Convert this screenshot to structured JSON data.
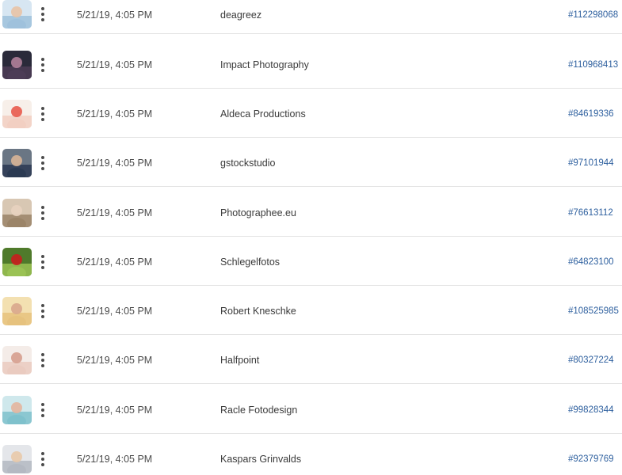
{
  "rows": [
    {
      "date": "5/21/19, 4:05 PM",
      "contributor": "deagreez",
      "asset_id": "#112298068",
      "thumb_icon": "man-portrait-photo-icon",
      "thumb_colors": [
        "#d7e6f2",
        "#9fc1dc",
        "#e9c3a6"
      ]
    },
    {
      "date": "5/21/19, 4:05 PM",
      "contributor": "Impact Photography",
      "asset_id": "#110968413",
      "thumb_icon": "dark-photo-icon",
      "thumb_colors": [
        "#2a2a3a",
        "#4c3c56",
        "#b0809a"
      ]
    },
    {
      "date": "5/21/19, 4:05 PM",
      "contributor": "Aldeca Productions",
      "asset_id": "#84619336",
      "thumb_icon": "neck-pain-photo-icon",
      "thumb_colors": [
        "#f7efe9",
        "#f2cfc2",
        "#e85a4d"
      ]
    },
    {
      "date": "5/21/19, 4:05 PM",
      "contributor": "gstockstudio",
      "asset_id": "#97101944",
      "thumb_icon": "business-people-photo-icon",
      "thumb_colors": [
        "#6a7684",
        "#2b3a52",
        "#d8b597"
      ]
    },
    {
      "date": "5/21/19, 4:05 PM",
      "contributor": "Photographee.eu",
      "asset_id": "#76613112",
      "thumb_icon": "woman-face-photo-icon",
      "thumb_colors": [
        "#d8c7b3",
        "#9b8468",
        "#e8d2bf"
      ]
    },
    {
      "date": "5/21/19, 4:05 PM",
      "contributor": "Schlegelfotos",
      "asset_id": "#64823100",
      "thumb_icon": "forest-photo-icon",
      "thumb_colors": [
        "#4f7a2b",
        "#9ac254",
        "#c81e1e"
      ]
    },
    {
      "date": "5/21/19, 4:05 PM",
      "contributor": "Robert Kneschke",
      "asset_id": "#108525985",
      "thumb_icon": "family-photo-icon",
      "thumb_colors": [
        "#f3e0b1",
        "#e6c27e",
        "#d9a78d"
      ]
    },
    {
      "date": "5/21/19, 4:05 PM",
      "contributor": "Halfpoint",
      "asset_id": "#80327224",
      "thumb_icon": "hands-photo-icon",
      "thumb_colors": [
        "#f4ece8",
        "#eacbc0",
        "#d69f8e"
      ]
    },
    {
      "date": "5/21/19, 4:05 PM",
      "contributor": "Racle Fotodesign",
      "asset_id": "#99828344",
      "thumb_icon": "woman-sofa-photo-icon",
      "thumb_colors": [
        "#cfe8ec",
        "#7fc1cc",
        "#e3b59f"
      ]
    },
    {
      "date": "5/21/19, 4:05 PM",
      "contributor": "Kaspars Grinvalds",
      "asset_id": "#92379769",
      "thumb_icon": "woman-headache-photo-icon",
      "thumb_colors": [
        "#e4e6ea",
        "#b4b9c2",
        "#e8c9aa"
      ]
    }
  ],
  "colors": {
    "link": "#2d5f9e",
    "text": "#4b4b4b",
    "divider": "#e3e3e3"
  }
}
